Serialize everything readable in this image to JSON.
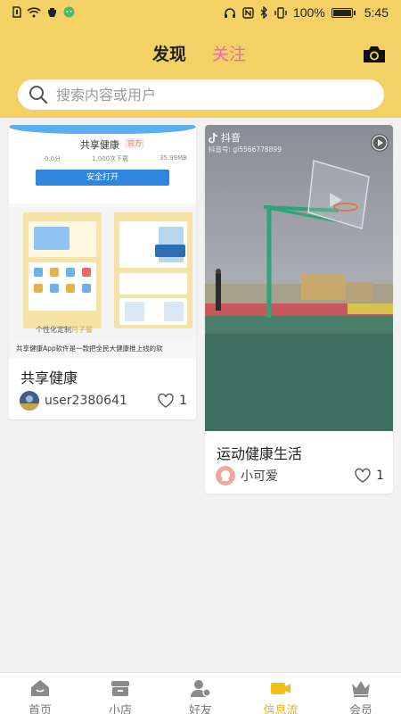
{
  "status_bar": {
    "battery_text": "100%",
    "battery_level": 1.0,
    "time": "5:45",
    "icons": [
      "sim-icon",
      "wifi-icon",
      "notification-icon",
      "wechat-icon",
      "headset-icon",
      "nfc-icon",
      "bluetooth-icon",
      "vibrate-icon",
      "battery-icon"
    ]
  },
  "header": {
    "tabs": [
      {
        "label": "发现",
        "active": true
      },
      {
        "label": "关注",
        "active": false
      }
    ],
    "camera_icon": "camera-icon",
    "search": {
      "placeholder": "搜索内容或用户",
      "icon": "search-icon"
    }
  },
  "feed": {
    "cards": [
      {
        "thumbnail": {
          "app_name": "共享健康",
          "app_tag": "官方",
          "stats": [
            "0.0分",
            "1,000次下载",
            "35.99MB"
          ],
          "open_button": "安全打开",
          "caption_prefix": "个性化定制",
          "caption_highlight": "月子餐",
          "description": "共享健康App软件是一款把全民大健康推上线的软"
        },
        "title": "共享健康",
        "username": "user2380641",
        "likes": "1"
      },
      {
        "thumbnail": {
          "platform": "抖音",
          "account_id": "抖音号: gi5566778899"
        },
        "title": "运动健康生活",
        "username": "小可爱",
        "likes": "1"
      }
    ]
  },
  "bottom_nav": {
    "items": [
      {
        "label": "首页",
        "icon": "home-icon",
        "active": false
      },
      {
        "label": "小店",
        "icon": "shop-icon",
        "active": false
      },
      {
        "label": "好友",
        "icon": "friends-icon",
        "active": false
      },
      {
        "label": "信息流",
        "icon": "video-icon",
        "active": true
      },
      {
        "label": "会员",
        "icon": "crown-icon",
        "active": false
      }
    ],
    "active_color": "#e6b417",
    "inactive_color": "#777777"
  },
  "colors": {
    "header_bg": "#f3d165",
    "follow_tab": "#e86ab3",
    "feed_bg": "#f2f2f2"
  }
}
